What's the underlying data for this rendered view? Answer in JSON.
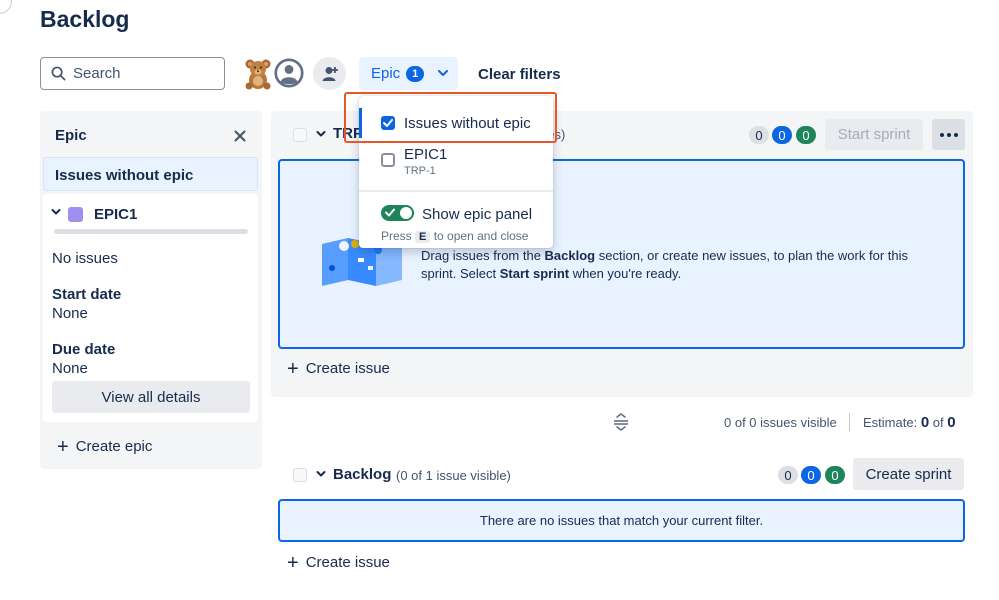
{
  "page": {
    "title": "Backlog"
  },
  "filters": {
    "search_placeholder": "Search",
    "epic_label": "Epic",
    "epic_count": "1",
    "clear_filters": "Clear filters"
  },
  "epic_panel": {
    "title": "Epic",
    "issues_without_epic": "Issues without epic",
    "epic_name": "EPIC1",
    "epic_color": "#9f8fef",
    "no_issues": "No issues",
    "start_date_label": "Start date",
    "start_date_value": "None",
    "due_date_label": "Due date",
    "due_date_value": "None",
    "view_all_details": "View all details",
    "create_epic": "Create epic"
  },
  "sprint": {
    "name": "TRP",
    "issue_count_fragment": "ues)",
    "counts": [
      "0",
      "0",
      "0"
    ],
    "start_sprint": "Start sprint",
    "empty_text_1": "Drag issues from the ",
    "empty_text_bold_1": "Backlog",
    "empty_text_2": " section, or create new issues, to plan the work for this sprint. Select ",
    "empty_text_bold_2": "Start sprint",
    "empty_text_3": " when you're ready.",
    "create_issue": "Create issue",
    "issues_visible": "0 of 0 issues visible",
    "estimate_label": "Estimate:",
    "estimate_value": "0",
    "estimate_of": "of",
    "estimate_total": "0"
  },
  "backlog": {
    "name": "Backlog",
    "issue_count": "(0 of 1 issue visible)",
    "counts": [
      "0",
      "0",
      "0"
    ],
    "create_sprint": "Create sprint",
    "empty_message": "There are no issues that match your current filter.",
    "create_issue": "Create issue"
  },
  "epic_dropdown": {
    "option_without_epic": "Issues without epic",
    "option_epic_name": "EPIC1",
    "option_epic_key": "TRP-1",
    "show_epic_panel": "Show epic panel",
    "hint_press": "Press",
    "hint_key": "E",
    "hint_rest": "to open and close"
  },
  "colors": {
    "accent": "#0c66e4",
    "success": "#1f845a",
    "highlight": "#e8572a"
  }
}
